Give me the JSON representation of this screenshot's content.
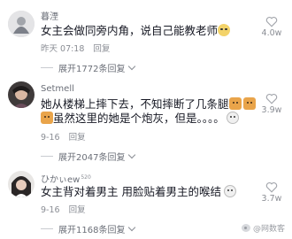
{
  "comments": [
    {
      "username": "暮湮",
      "badge": "",
      "text_parts": [
        "女主会做同旁内角，说自己能教老师"
      ],
      "emojis": [
        "grinning-face-emoji"
      ],
      "meta_time": "昨天 07:18",
      "reply_label": "回复",
      "likes": "4.0w",
      "expand_label": "展开1772条回复"
    },
    {
      "username": "Setmell",
      "badge": "",
      "text_line1": "她从楼梯上摔下去，不知摔断了几条腿",
      "text_line2": "虽然这里的她是个炮灰，但是。。。。",
      "emojis": [
        "dog-face-emoji",
        "dog-face-emoji",
        "dog-face-emoji",
        "cat-face-emoji"
      ],
      "meta_time": "9-16",
      "reply_label": "回复",
      "likes": "3.9w",
      "expand_label": "展开2047条回复"
    },
    {
      "username": "ひかぃew",
      "badge": "520",
      "text": "女主背对着男主 用脸贴着男主的喉结",
      "emojis": [
        "cat-face-emoji"
      ],
      "meta_time": "9-16",
      "reply_label": "回复",
      "likes": "3.7w",
      "expand_label": "展开1168条回复"
    }
  ],
  "watermark": "@网数客",
  "colors": {
    "text": "#161823",
    "secondary": "#8a8d94",
    "name": "#6b6f78"
  }
}
